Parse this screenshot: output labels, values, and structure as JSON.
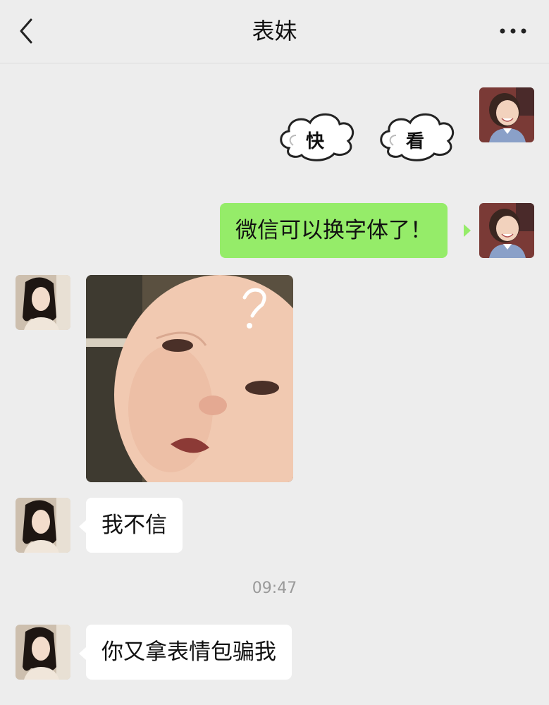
{
  "header": {
    "title": "表妹"
  },
  "messages": [
    {
      "from": "me",
      "type": "sticker",
      "chars": [
        "快",
        "看"
      ]
    },
    {
      "from": "me",
      "type": "text",
      "text": "微信可以换字体了！"
    },
    {
      "from": "cousin",
      "type": "image"
    },
    {
      "from": "cousin",
      "type": "text",
      "text": "我不信"
    },
    {
      "from": "cousin",
      "type": "text",
      "text": "你又拿表情包骗我"
    }
  ],
  "timestamp": "09:47",
  "colors": {
    "background": "#ededed",
    "my_bubble": "#95ec69",
    "their_bubble": "#ffffff",
    "timestamp": "#9a9a9a"
  },
  "icons": {
    "back": "chevron-left-icon",
    "more": "more-dots-icon"
  }
}
